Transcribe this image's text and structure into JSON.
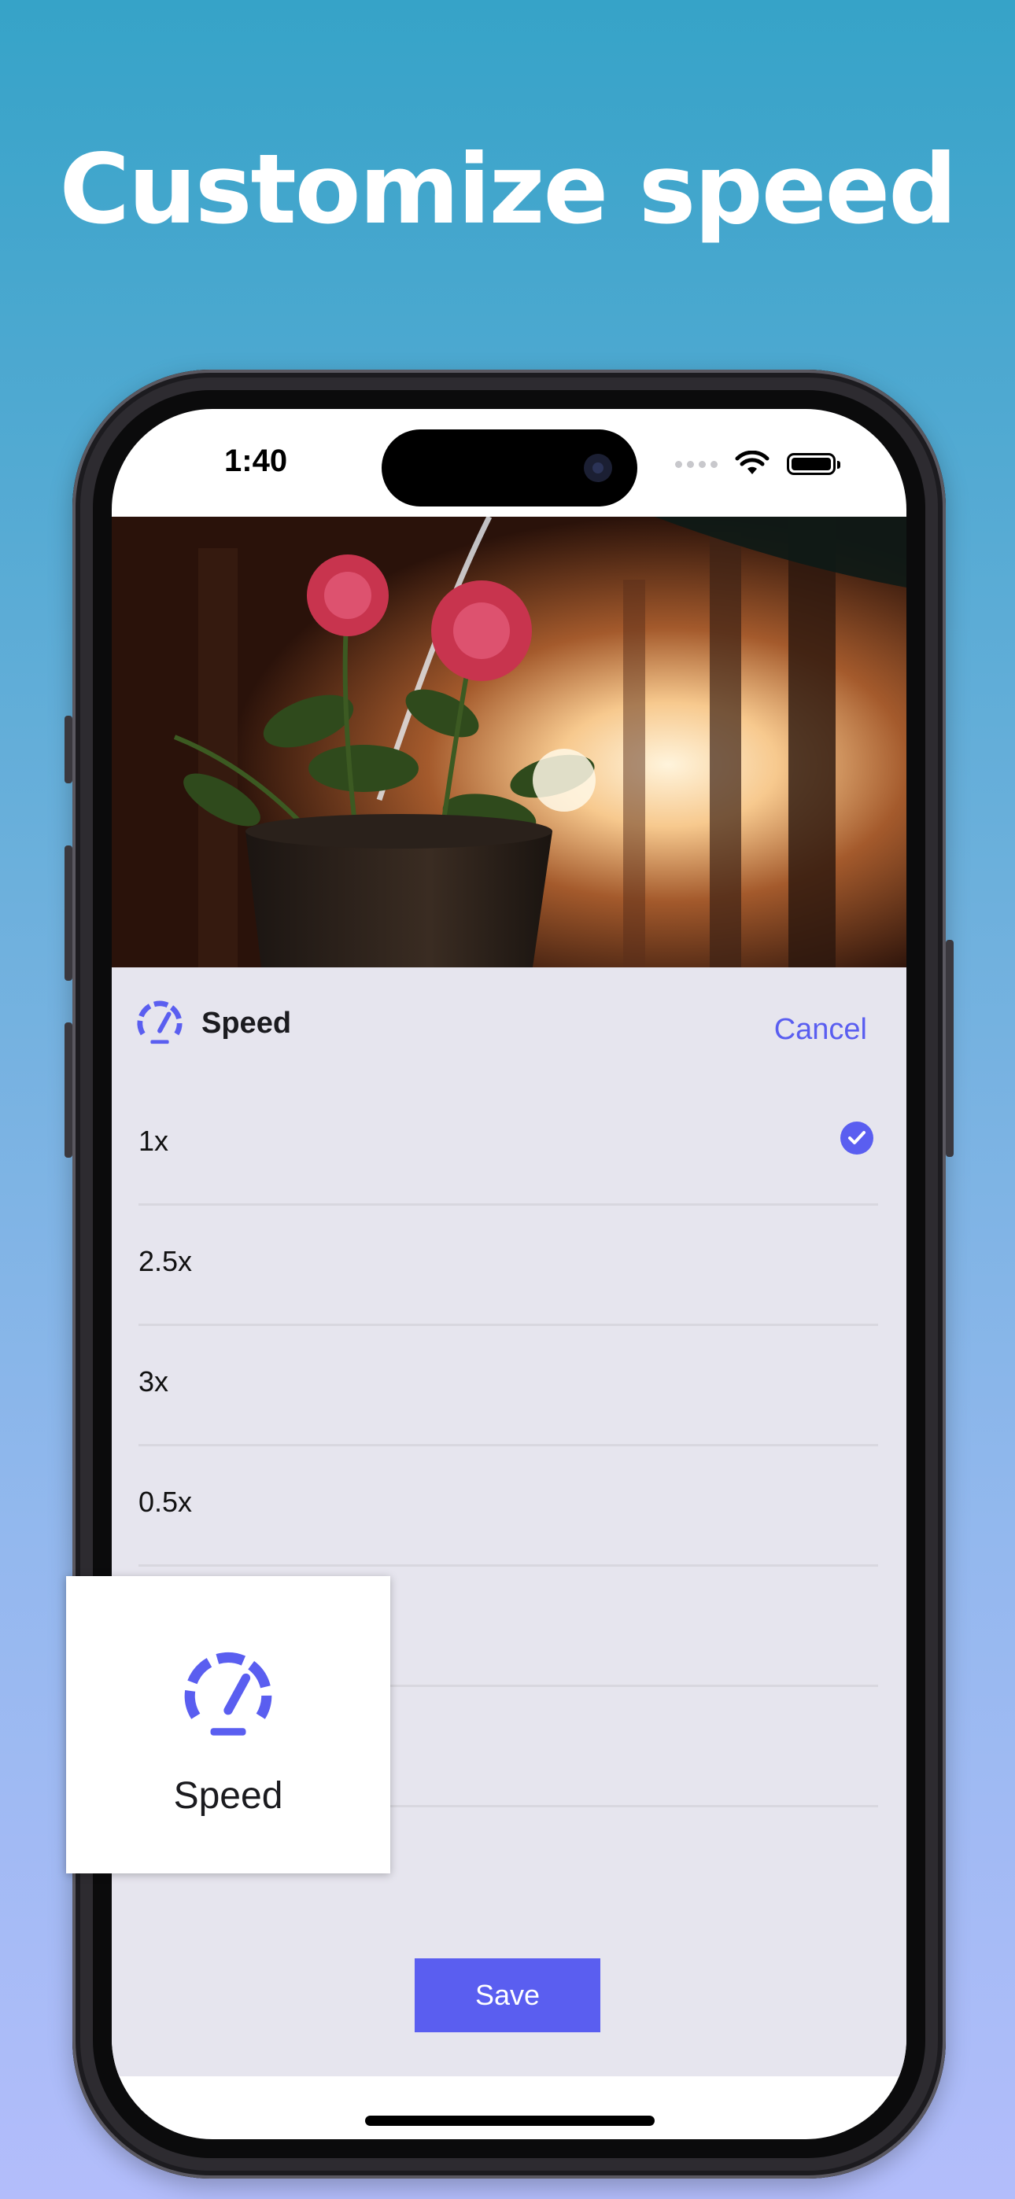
{
  "headline": "Customize speed",
  "status_bar": {
    "time": "1:40",
    "icons": [
      "cellular-dots-icon",
      "wifi-icon",
      "battery-icon"
    ]
  },
  "video": {
    "description_icon": "video-preview"
  },
  "sheet": {
    "title": "Speed",
    "cancel_label": "Cancel",
    "options": [
      {
        "label": "1x",
        "selected": true
      },
      {
        "label": "2.5x",
        "selected": false
      },
      {
        "label": "3x",
        "selected": false
      },
      {
        "label": "0.5x",
        "selected": false
      },
      {
        "label": "",
        "selected": false
      },
      {
        "label": "",
        "selected": false
      }
    ],
    "save_label": "Save"
  },
  "feature_card": {
    "label": "Speed",
    "icon": "speedometer-icon"
  },
  "colors": {
    "accent": "#5a5ef0",
    "sheet_bg": "#e6e5ee",
    "headline": "#ffffff"
  }
}
